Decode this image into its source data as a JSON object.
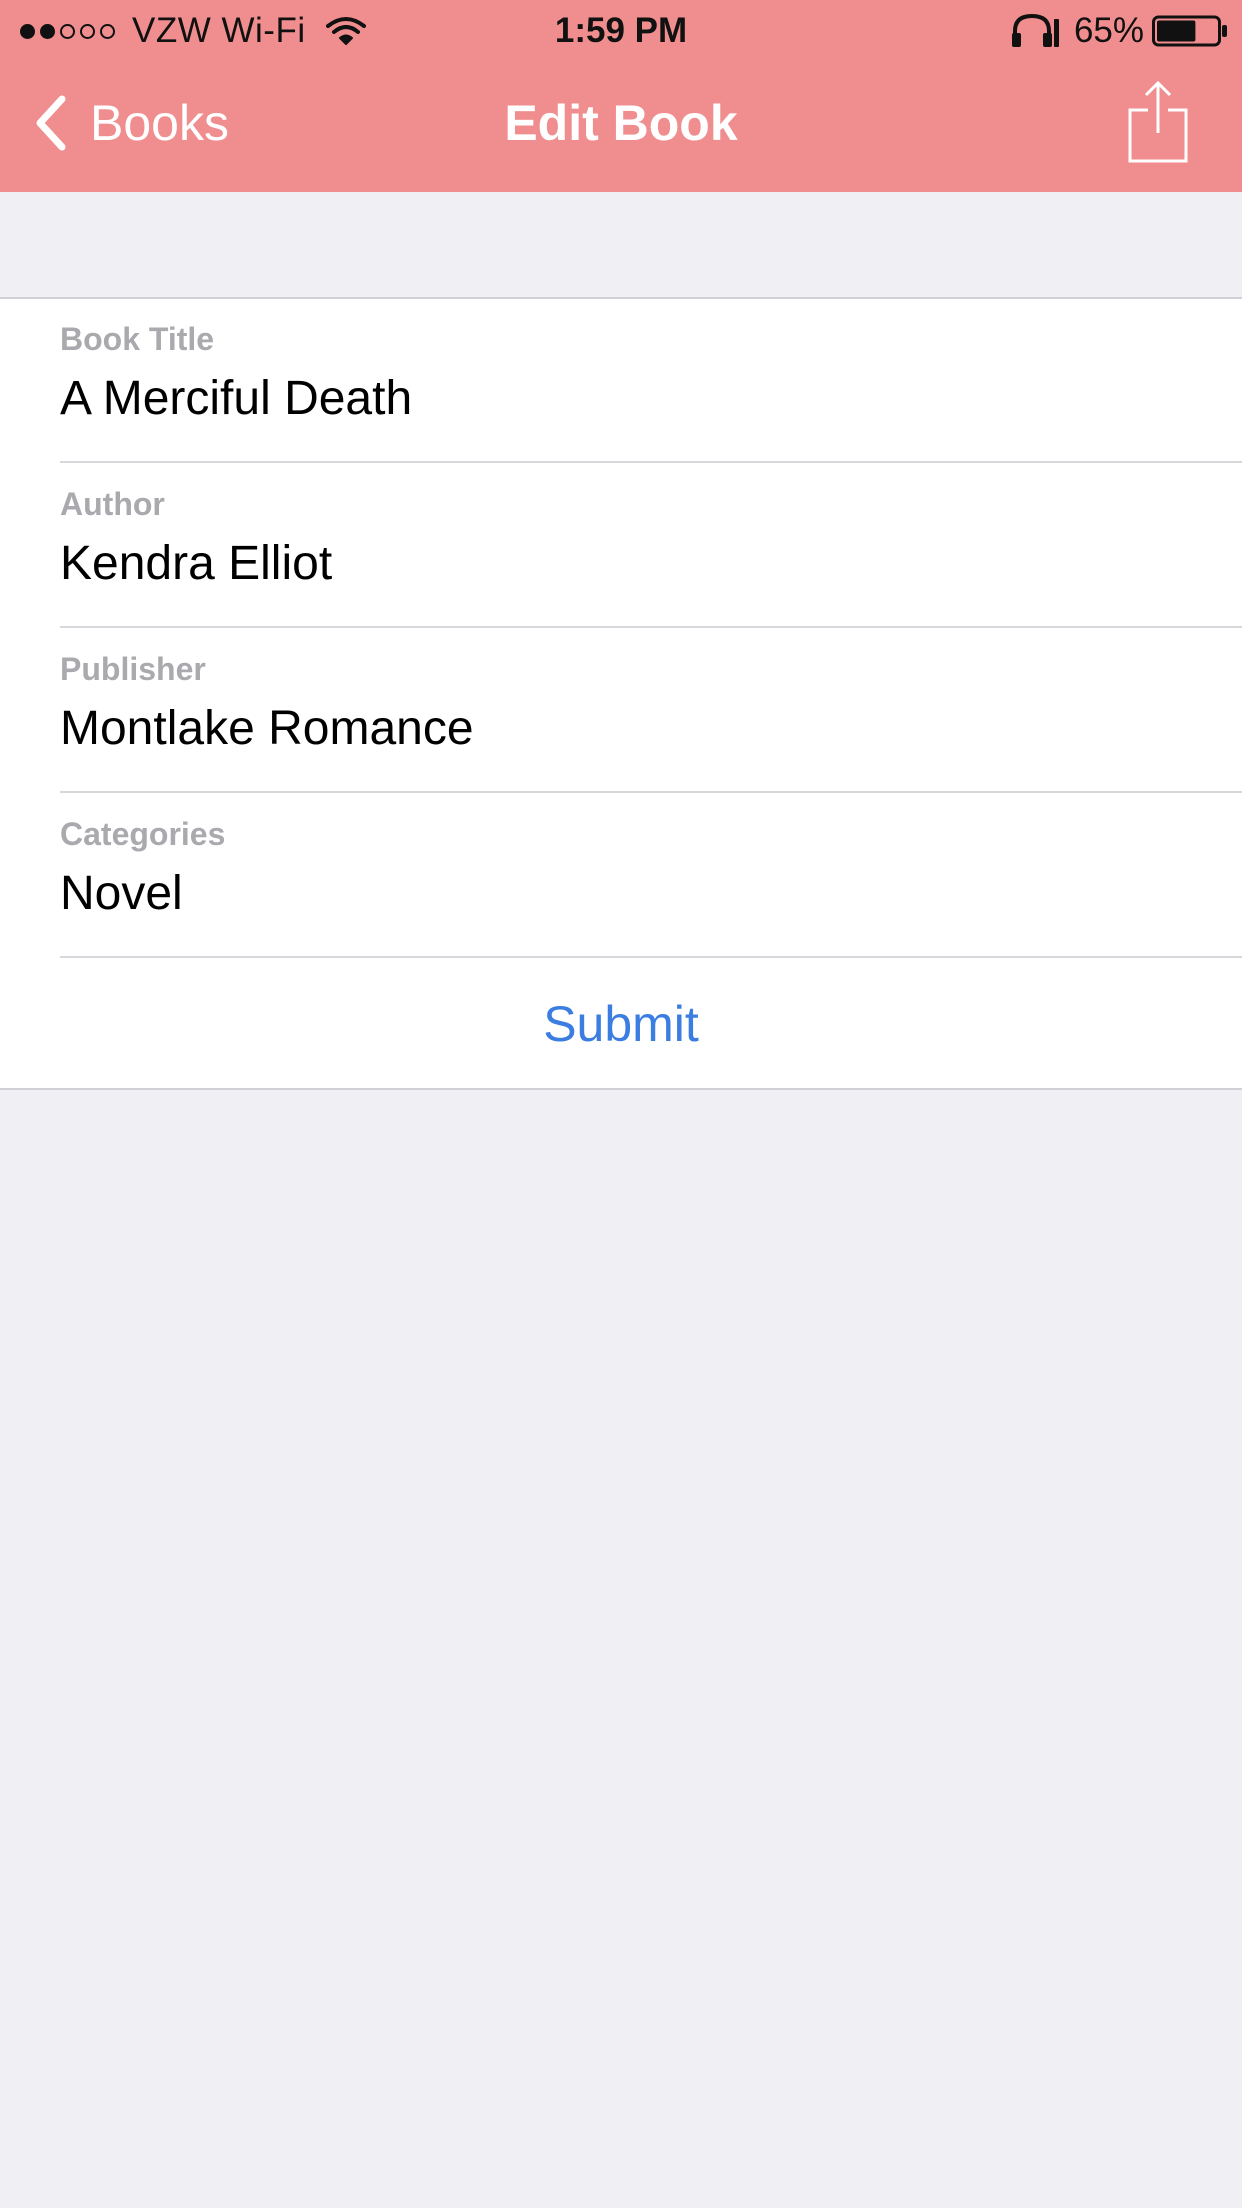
{
  "status_bar": {
    "signal_dots_filled": 2,
    "signal_dots_total": 5,
    "carrier": "VZW Wi-Fi",
    "time": "1:59 PM",
    "battery_percent": "65%",
    "battery_level": 0.65,
    "icons": [
      "wifi-icon",
      "headphones-icon",
      "battery-icon"
    ]
  },
  "nav": {
    "back_label": "Books",
    "title": "Edit Book",
    "back_icon": "chevron-left-icon",
    "share_icon": "share-icon",
    "bar_color": "#f08e8f"
  },
  "form": {
    "fields": [
      {
        "label": "Book Title",
        "value": "A Merciful Death"
      },
      {
        "label": "Author",
        "value": "Kendra Elliot"
      },
      {
        "label": "Publisher",
        "value": "Montlake Romance"
      },
      {
        "label": "Categories",
        "value": "Novel"
      }
    ],
    "submit_label": "Submit",
    "submit_color": "#3b7de0"
  }
}
